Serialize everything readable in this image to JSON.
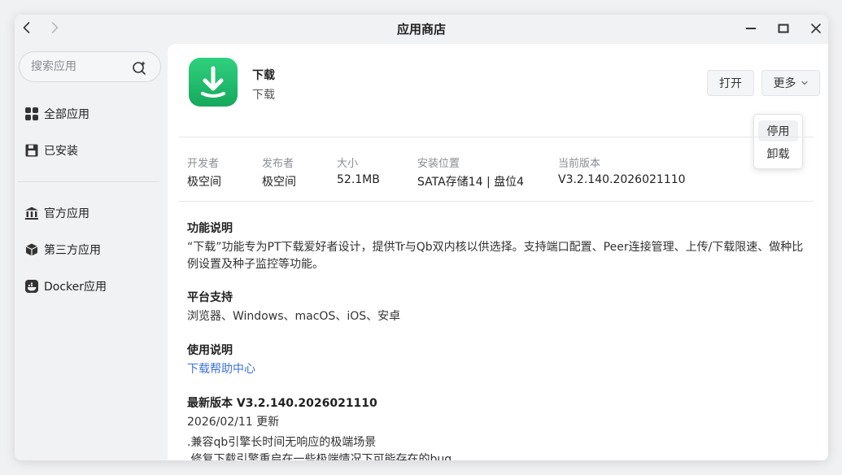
{
  "window": {
    "title": "应用商店"
  },
  "sidebar": {
    "search_placeholder": "搜索应用",
    "items": [
      {
        "label": "全部应用",
        "icon": "grid-icon"
      },
      {
        "label": "已安装",
        "icon": "save-disk-icon"
      },
      {
        "label": "官方应用",
        "icon": "bank-building-icon"
      },
      {
        "label": "第三方应用",
        "icon": "package-box-icon"
      },
      {
        "label": "Docker应用",
        "icon": "docker-icon"
      }
    ]
  },
  "app": {
    "name": "下载",
    "subtitle": "下载",
    "icon": "download-arrow-icon",
    "icon_colors": [
      "#2fd17e",
      "#16a85c"
    ]
  },
  "actions": {
    "open_label": "打开",
    "more_label": "更多",
    "menu": [
      "停用",
      "卸载"
    ]
  },
  "meta": [
    {
      "label": "开发者",
      "value": "极空间"
    },
    {
      "label": "发布者",
      "value": "极空间"
    },
    {
      "label": "大小",
      "value": "52.1MB"
    },
    {
      "label": "安装位置",
      "value": "SATA存储14 | 盘位4"
    },
    {
      "label": "当前版本",
      "value": "V3.2.140.2026021110"
    }
  ],
  "sections": {
    "features_title": "功能说明",
    "features_line1": "“下载”功能专为PT下载爱好者设计，提供Tr与Qb双内核以供选择。支持端口配置、Peer连接管理、上传/下载限速、做种比",
    "features_line2": "例设置及种子监控等功能。",
    "platforms_title": "平台支持",
    "platforms_text": "浏览器、Windows、macOS、iOS、安卓",
    "usage_title": "使用说明",
    "usage_link": "下载帮助中心",
    "latest_title": "最新版本 V3.2.140.2026021110",
    "latest_date": "2026/02/11 更新",
    "changes": [
      ".兼容qb引擎长时间无响应的极端场景",
      ".修复下载引擎重启在一些极端情况下可能存在的bug"
    ]
  },
  "colors": {
    "link": "#3b73d9",
    "accent_green": "#1fbf6b"
  }
}
